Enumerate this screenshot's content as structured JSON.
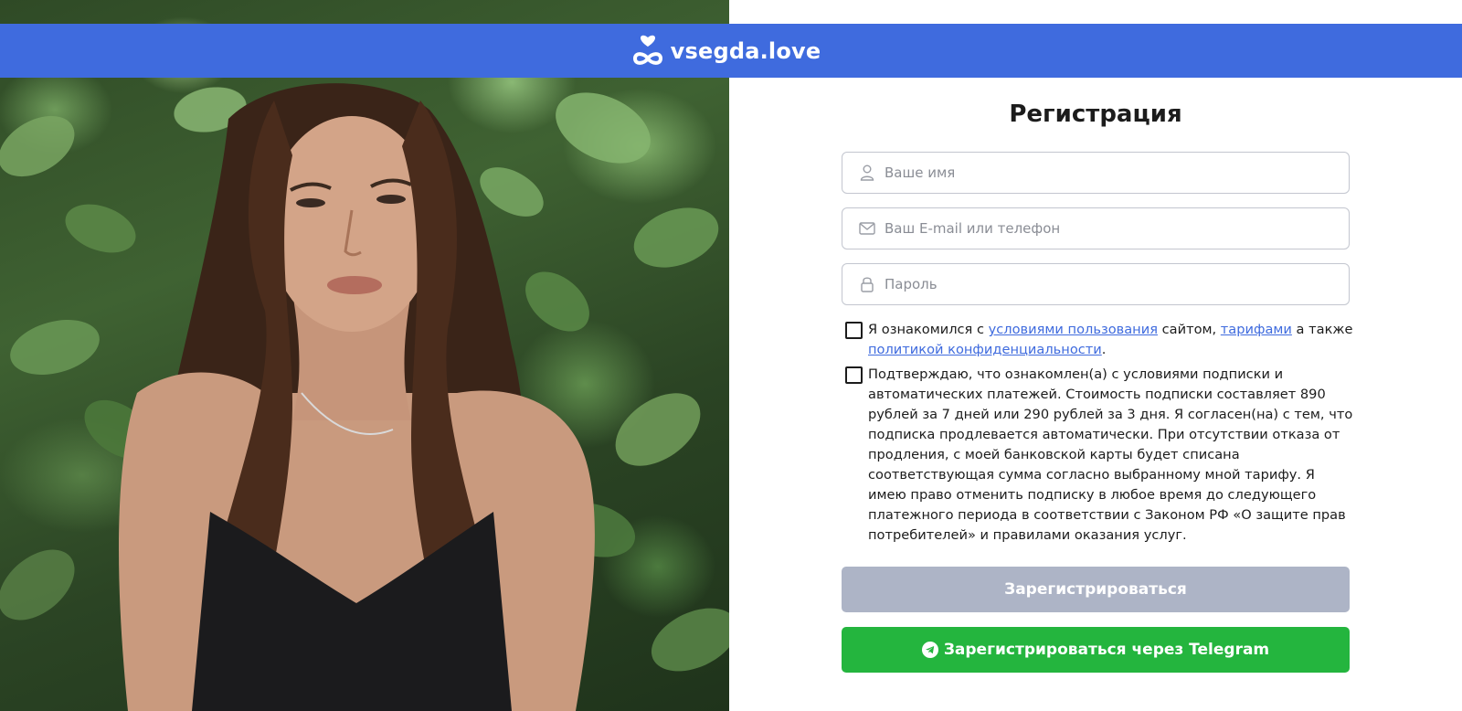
{
  "header": {
    "brand_name": "vsegda.love",
    "logo_icon": "heart-infinity-icon",
    "bg_color": "#3f6bde"
  },
  "photo": {
    "subject": "woman-portrait-image"
  },
  "form": {
    "title": "Регистрация",
    "name_field": {
      "placeholder": "Ваше имя",
      "icon": "user-icon",
      "value": ""
    },
    "contact_field": {
      "placeholder": "Ваш E-mail или телефон",
      "icon": "mail-icon",
      "value": ""
    },
    "password_field": {
      "placeholder": "Пароль",
      "icon": "lock-icon",
      "value": ""
    },
    "terms_checkbox": {
      "checked": false,
      "text_1": "Я ознакомился с ",
      "link_terms": "условиями пользования",
      "text_2": " сайтом, ",
      "link_tariffs": "тарифами",
      "text_3": " а также ",
      "link_privacy": "политикой конфиденциальности",
      "text_4": "."
    },
    "subscription_checkbox": {
      "checked": false,
      "text": "Подтверждаю, что ознакомлен(а) с условиями подписки и автоматических платежей. Стоимость подписки составляет 890 рублей за 7 дней или 290 рублей за 3 дня. Я согласен(на) с тем, что подписка продлевается автоматически. При отсутствии отказа от продления, с моей банковской карты будет списана соответствующая сумма согласно выбранному мной тарифу. Я имею право отменить подписку в любое время до следующего платежного периода в соответствии с Законом РФ «О защите прав потребителей» и правилами оказания услуг."
    },
    "register_button": {
      "label": "Зарегистрироваться",
      "color": "#adb4c6"
    },
    "telegram_button": {
      "label": "Зарегистрироваться через Telegram",
      "icon": "telegram-icon",
      "color": "#24b53e"
    },
    "link_color": "#3f6bde"
  }
}
